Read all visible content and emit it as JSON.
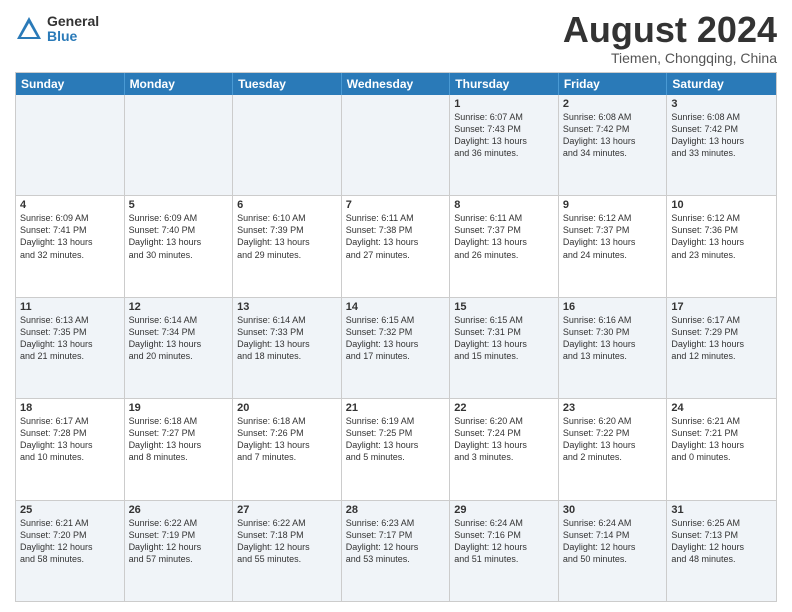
{
  "header": {
    "logo": {
      "general": "General",
      "blue": "Blue"
    },
    "title": "August 2024",
    "location": "Tiemen, Chongqing, China"
  },
  "weekdays": [
    "Sunday",
    "Monday",
    "Tuesday",
    "Wednesday",
    "Thursday",
    "Friday",
    "Saturday"
  ],
  "rows": [
    [
      {
        "day": "",
        "detail": ""
      },
      {
        "day": "",
        "detail": ""
      },
      {
        "day": "",
        "detail": ""
      },
      {
        "day": "",
        "detail": ""
      },
      {
        "day": "1",
        "detail": "Sunrise: 6:07 AM\nSunset: 7:43 PM\nDaylight: 13 hours\nand 36 minutes."
      },
      {
        "day": "2",
        "detail": "Sunrise: 6:08 AM\nSunset: 7:42 PM\nDaylight: 13 hours\nand 34 minutes."
      },
      {
        "day": "3",
        "detail": "Sunrise: 6:08 AM\nSunset: 7:42 PM\nDaylight: 13 hours\nand 33 minutes."
      }
    ],
    [
      {
        "day": "4",
        "detail": "Sunrise: 6:09 AM\nSunset: 7:41 PM\nDaylight: 13 hours\nand 32 minutes."
      },
      {
        "day": "5",
        "detail": "Sunrise: 6:09 AM\nSunset: 7:40 PM\nDaylight: 13 hours\nand 30 minutes."
      },
      {
        "day": "6",
        "detail": "Sunrise: 6:10 AM\nSunset: 7:39 PM\nDaylight: 13 hours\nand 29 minutes."
      },
      {
        "day": "7",
        "detail": "Sunrise: 6:11 AM\nSunset: 7:38 PM\nDaylight: 13 hours\nand 27 minutes."
      },
      {
        "day": "8",
        "detail": "Sunrise: 6:11 AM\nSunset: 7:37 PM\nDaylight: 13 hours\nand 26 minutes."
      },
      {
        "day": "9",
        "detail": "Sunrise: 6:12 AM\nSunset: 7:37 PM\nDaylight: 13 hours\nand 24 minutes."
      },
      {
        "day": "10",
        "detail": "Sunrise: 6:12 AM\nSunset: 7:36 PM\nDaylight: 13 hours\nand 23 minutes."
      }
    ],
    [
      {
        "day": "11",
        "detail": "Sunrise: 6:13 AM\nSunset: 7:35 PM\nDaylight: 13 hours\nand 21 minutes."
      },
      {
        "day": "12",
        "detail": "Sunrise: 6:14 AM\nSunset: 7:34 PM\nDaylight: 13 hours\nand 20 minutes."
      },
      {
        "day": "13",
        "detail": "Sunrise: 6:14 AM\nSunset: 7:33 PM\nDaylight: 13 hours\nand 18 minutes."
      },
      {
        "day": "14",
        "detail": "Sunrise: 6:15 AM\nSunset: 7:32 PM\nDaylight: 13 hours\nand 17 minutes."
      },
      {
        "day": "15",
        "detail": "Sunrise: 6:15 AM\nSunset: 7:31 PM\nDaylight: 13 hours\nand 15 minutes."
      },
      {
        "day": "16",
        "detail": "Sunrise: 6:16 AM\nSunset: 7:30 PM\nDaylight: 13 hours\nand 13 minutes."
      },
      {
        "day": "17",
        "detail": "Sunrise: 6:17 AM\nSunset: 7:29 PM\nDaylight: 13 hours\nand 12 minutes."
      }
    ],
    [
      {
        "day": "18",
        "detail": "Sunrise: 6:17 AM\nSunset: 7:28 PM\nDaylight: 13 hours\nand 10 minutes."
      },
      {
        "day": "19",
        "detail": "Sunrise: 6:18 AM\nSunset: 7:27 PM\nDaylight: 13 hours\nand 8 minutes."
      },
      {
        "day": "20",
        "detail": "Sunrise: 6:18 AM\nSunset: 7:26 PM\nDaylight: 13 hours\nand 7 minutes."
      },
      {
        "day": "21",
        "detail": "Sunrise: 6:19 AM\nSunset: 7:25 PM\nDaylight: 13 hours\nand 5 minutes."
      },
      {
        "day": "22",
        "detail": "Sunrise: 6:20 AM\nSunset: 7:24 PM\nDaylight: 13 hours\nand 3 minutes."
      },
      {
        "day": "23",
        "detail": "Sunrise: 6:20 AM\nSunset: 7:22 PM\nDaylight: 13 hours\nand 2 minutes."
      },
      {
        "day": "24",
        "detail": "Sunrise: 6:21 AM\nSunset: 7:21 PM\nDaylight: 13 hours\nand 0 minutes."
      }
    ],
    [
      {
        "day": "25",
        "detail": "Sunrise: 6:21 AM\nSunset: 7:20 PM\nDaylight: 12 hours\nand 58 minutes."
      },
      {
        "day": "26",
        "detail": "Sunrise: 6:22 AM\nSunset: 7:19 PM\nDaylight: 12 hours\nand 57 minutes."
      },
      {
        "day": "27",
        "detail": "Sunrise: 6:22 AM\nSunset: 7:18 PM\nDaylight: 12 hours\nand 55 minutes."
      },
      {
        "day": "28",
        "detail": "Sunrise: 6:23 AM\nSunset: 7:17 PM\nDaylight: 12 hours\nand 53 minutes."
      },
      {
        "day": "29",
        "detail": "Sunrise: 6:24 AM\nSunset: 7:16 PM\nDaylight: 12 hours\nand 51 minutes."
      },
      {
        "day": "30",
        "detail": "Sunrise: 6:24 AM\nSunset: 7:14 PM\nDaylight: 12 hours\nand 50 minutes."
      },
      {
        "day": "31",
        "detail": "Sunrise: 6:25 AM\nSunset: 7:13 PM\nDaylight: 12 hours\nand 48 minutes."
      }
    ]
  ],
  "altRows": [
    0,
    2,
    4
  ]
}
